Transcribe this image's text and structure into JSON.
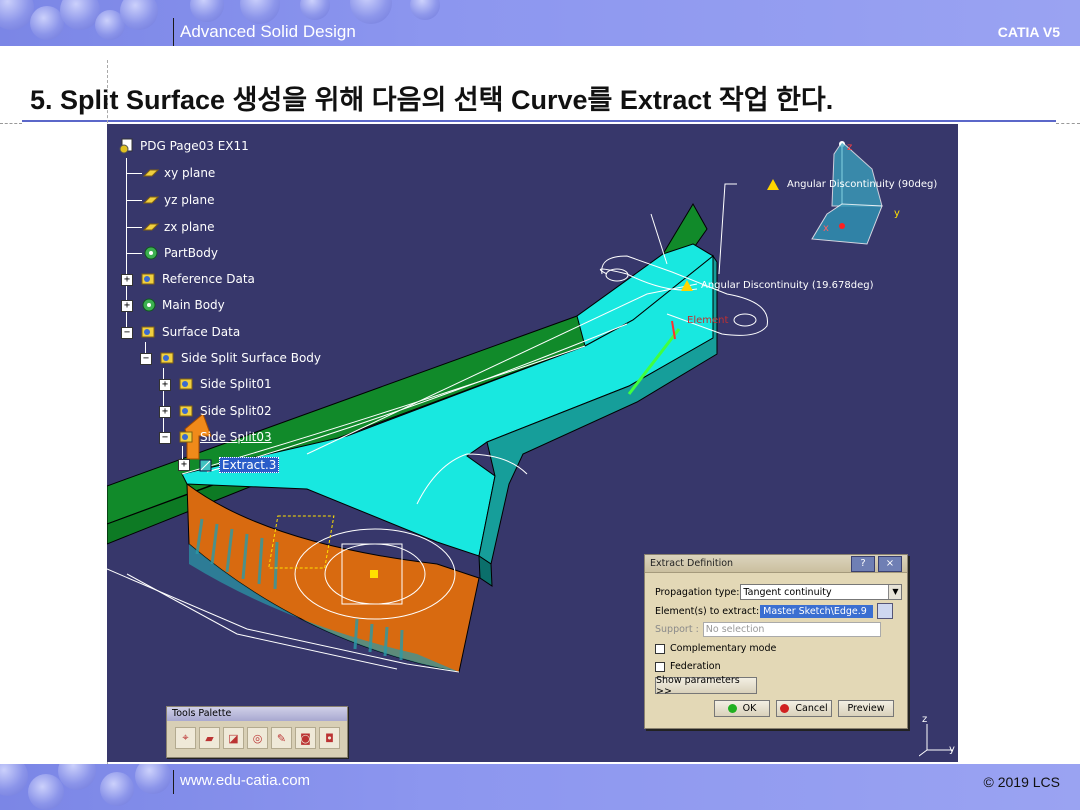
{
  "header": {
    "course": "Advanced Solid Design",
    "product": "CATIA V5"
  },
  "footer": {
    "website": "www.edu-catia.com",
    "copyright": "© 2019 LCS"
  },
  "slide": {
    "title": "5. Split Surface 생성을 위해 다음의 선택 Curve를 Extract 작업 한다."
  },
  "tree": {
    "items": [
      {
        "label": "PDG Page03 EX11",
        "icon": "part-icon"
      },
      {
        "label": "xy plane",
        "icon": "plane-icon"
      },
      {
        "label": "yz plane",
        "icon": "plane-icon"
      },
      {
        "label": "zx plane",
        "icon": "plane-icon"
      },
      {
        "label": "PartBody",
        "icon": "body-gear-icon"
      },
      {
        "label": "Reference Data",
        "icon": "geometrical-set-icon"
      },
      {
        "label": "Main Body",
        "icon": "body-gear-icon"
      },
      {
        "label": "Surface Data",
        "icon": "geometrical-set-icon"
      },
      {
        "label": "Side Split Surface Body",
        "icon": "geometrical-set-icon"
      },
      {
        "label": "Side Split01",
        "icon": "geometrical-set-icon"
      },
      {
        "label": "Side Split02",
        "icon": "geometrical-set-icon"
      },
      {
        "label": "Side Split03",
        "icon": "geometrical-set-icon"
      },
      {
        "label": "Extract.3",
        "icon": "extract-icon"
      }
    ]
  },
  "annotations": {
    "angular_discontinuity_1": "Angular Discontinuity (90deg)",
    "angular_discontinuity_2": "Angular Discontinuity (19.678deg)",
    "element_label": "Element",
    "compass_x": "x",
    "compass_y": "y",
    "compass_z": "z",
    "axis_z": "z",
    "axis_y": "y"
  },
  "extract_dialog": {
    "title": "Extract Definition",
    "help_button": "?",
    "close_button": "×",
    "propagation_label": "Propagation type:",
    "propagation_value": "Tangent continuity",
    "elements_label": "Element(s) to extract:",
    "elements_value": "Master Sketch\\Edge.9",
    "support_label": "Support :",
    "support_value": "No selection",
    "complementary_label": "Complementary mode",
    "federation_label": "Federation",
    "show_params_label": "Show parameters >>",
    "ok_label": "OK",
    "cancel_label": "Cancel",
    "preview_label": "Preview"
  },
  "tools_palette": {
    "title": "Tools Palette",
    "icons": [
      "snap-icon",
      "folder-icon",
      "select-icon",
      "search-icon",
      "tools-icon",
      "camera-icon",
      "capture-icon"
    ]
  },
  "colors": {
    "viewport_bg": "#37376b",
    "surface_cyan": "#18e8e0",
    "surface_green": "#118a2a",
    "solid_orange": "#d86a10",
    "banner_blue": "#8a94ee"
  }
}
